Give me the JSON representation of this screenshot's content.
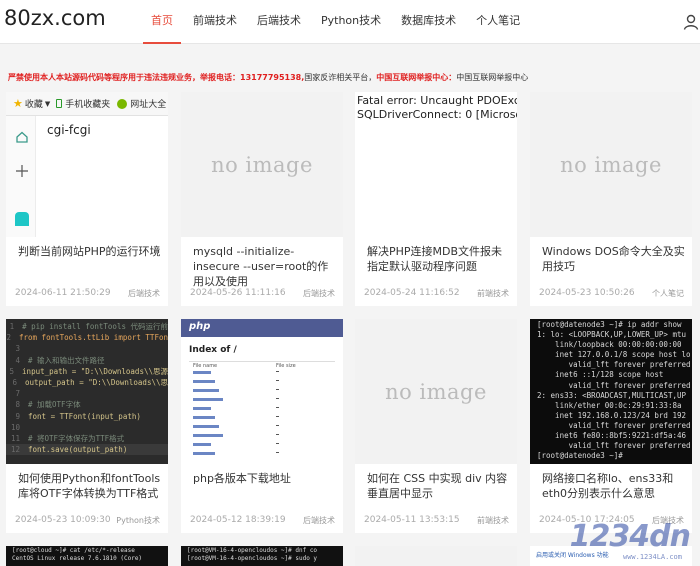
{
  "header": {
    "logo": "80zx.com",
    "nav": [
      "首页",
      "前端技术",
      "后端技术",
      "Python技术",
      "数据库技术",
      "个人笔记"
    ]
  },
  "notice": {
    "part1": "严禁使用本人本站源码代码等程序用于违法违规业务，举报电话：13177795138,",
    "part2": "国家反诈相关平台，",
    "part3": "中国互联网举报中心：",
    "part4": "中国互联网举报中心"
  },
  "no_image_text": "no image",
  "cards": [
    {
      "title": "判断当前网站PHP的运行环境",
      "date": "2024-06-11 21:50:29",
      "category": "后端技术"
    },
    {
      "title": "mysqld --initialize-insecure --user=root的作用以及使用",
      "date": "2024-05-26 11:11:16",
      "category": "后端技术"
    },
    {
      "title": "解决PHP连接MDB文件报未指定默认驱动程序问题",
      "date": "2024-05-24 11:16:52",
      "category": "前端技术"
    },
    {
      "title": "Windows DOS命令大全及实用技巧",
      "date": "2024-05-23 10:50:26",
      "category": "个人笔记"
    },
    {
      "title": "如何使用Python和fontTools库将OTF字体转换为TTF格式",
      "date": "2024-05-23 10:09:30",
      "category": "Python技术"
    },
    {
      "title": "php各版本下载地址",
      "date": "2024-05-12 18:39:19",
      "category": "后端技术"
    },
    {
      "title": "如何在 CSS 中实现 div 内容垂直居中显示",
      "date": "2024-05-11 13:53:15",
      "category": "前端技术"
    },
    {
      "title": "网络接口名称lo、ens33和eth0分别表示什么意思",
      "date": "2024-05-10 17:24:05",
      "category": "后端技术"
    }
  ],
  "thumb1": {
    "toolbar": [
      "收藏",
      "手机收藏夹",
      "网址大全"
    ],
    "text": "cgi-fcgi"
  },
  "thumb3": {
    "line1": "Fatal error: Uncaught PDOExceptio",
    "line2": "SQLDriverConnect: 0 [Microsoft][O"
  },
  "thumb5": {
    "lines": [
      {
        "n": "1",
        "t": "# pip install fontTools 代码运行前",
        "c": "#7a8a7a"
      },
      {
        "n": "2",
        "t": "from fontTools.ttLib import TTFon",
        "c": "#e6a65c"
      },
      {
        "n": "3",
        "t": "",
        "c": "#ccc"
      },
      {
        "n": "4",
        "t": "# 输入和输出文件路径",
        "c": "#7a8a7a"
      },
      {
        "n": "5",
        "t": "input_path = \"D:\\\\Downloads\\\\思源",
        "c": "#d4c48a"
      },
      {
        "n": "6",
        "t": "output_path = \"D:\\\\Downloads\\\\思",
        "c": "#d4c48a"
      },
      {
        "n": "7",
        "t": "",
        "c": "#ccc"
      },
      {
        "n": "8",
        "t": "# 加载OTF字体",
        "c": "#7a8a7a"
      },
      {
        "n": "9",
        "t": "font = TTFont(input_path)",
        "c": "#d4c48a"
      },
      {
        "n": "10",
        "t": "",
        "c": "#ccc"
      },
      {
        "n": "11",
        "t": "# 将OTF字体保存为TTF格式",
        "c": "#7a8a7a"
      },
      {
        "n": "12",
        "t": "font.save(output_path)",
        "c": "#d4c48a"
      }
    ]
  },
  "thumb6": {
    "brand": "php",
    "heading": "Index of /",
    "col1": "File name",
    "col2": "File size"
  },
  "thumb8": {
    "lines": [
      "[root@datenode3 ~]# ip addr show",
      "1: lo: <LOOPBACK,UP,LOWER_UP> mtu",
      "    link/loopback 00:00:00:00:00",
      "    inet 127.0.0.1/8 scope host lo",
      "       valid_lft forever preferred",
      "    inet6 ::1/128 scope host",
      "       valid_lft forever preferred",
      "2: ens33: <BROADCAST,MULTICAST,UP",
      "    link/ether 00:0c:29:91:33:8a",
      "    inet 192.168.0.123/24 brd 192",
      "       valid_lft forever preferred",
      "    inet6 fe80::8bf5:9221:df5a:46",
      "       valid_lft forever preferred",
      "[root@datenode3 ~]#"
    ]
  },
  "row3": {
    "t1a": "[root@cloud ~]# cat /etc/*-release",
    "t1b": "CentOS Linux release 7.6.1810 (Core)",
    "t2a": "[root@VM-16-4-opencloudos ~]# dnf co",
    "t2b": "[root@VM-16-4-opencloudos ~]# sudo y",
    "t4": "启用或关闭 Windows 功能"
  },
  "watermark": {
    "num": "1234dn",
    "sub": "www.1234LA.com"
  }
}
